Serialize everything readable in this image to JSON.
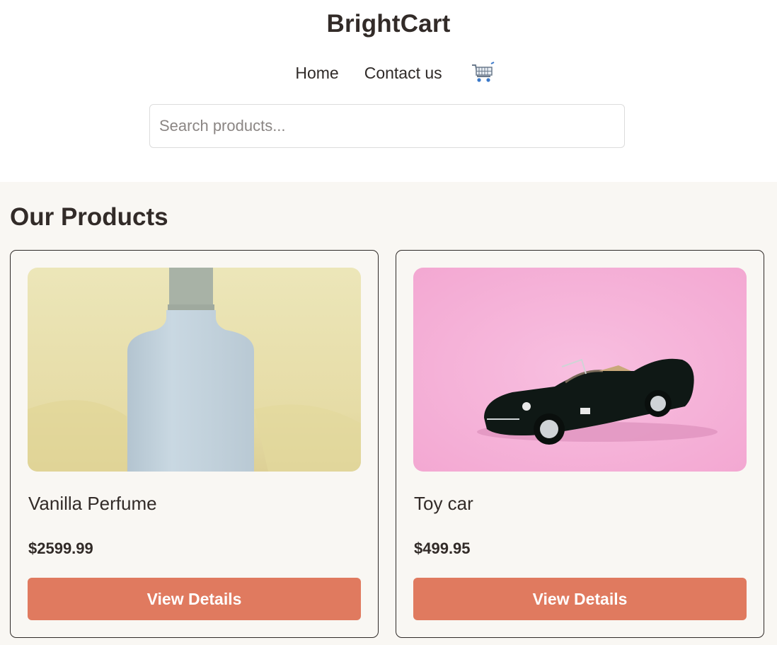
{
  "header": {
    "brand": "BrightCart",
    "nav": [
      {
        "label": "Home"
      },
      {
        "label": "Contact us"
      }
    ],
    "cart_icon": "shopping-cart-icon",
    "search_placeholder": "Search products..."
  },
  "main": {
    "title": "Our Products",
    "products": [
      {
        "name": "Vanilla Perfume",
        "price": "$2599.99",
        "button": "View Details",
        "image": "perfume-bottle-image"
      },
      {
        "name": "Toy car",
        "price": "$499.95",
        "button": "View Details",
        "image": "toy-car-image"
      }
    ]
  },
  "colors": {
    "accent": "#e07a5f",
    "page_bg": "#f9f7f3",
    "text": "#322b28"
  }
}
